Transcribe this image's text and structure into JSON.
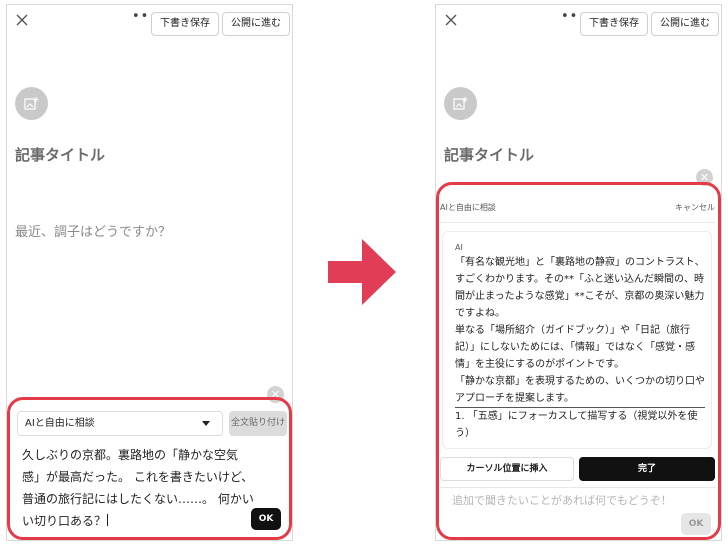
{
  "editor": {
    "more_menu": "•••",
    "draft_button": "下書き保存",
    "publish_button": "公開に進む",
    "title_placeholder": "記事タイトル",
    "body_placeholder": "最近、調子はどうですか？"
  },
  "left_panel": {
    "mode_select": "AIと自由に相談",
    "paste_all_button": "全文貼り付け",
    "input_lines": [
      "久しぶりの京都。裏路地の「静かな空気",
      "感」が最高だった。 これを書きたいけど、",
      "普通の旅行記にはしたくない……。 何かい",
      "い切り口ある？"
    ],
    "ok_button": "OK"
  },
  "right_panel": {
    "header_title": "AIと自由に相談",
    "cancel_label": "キャンセル",
    "ai_label": "AI",
    "ai_paragraphs": [
      "「有名な観光地」と「裏路地の静寂」のコントラスト、すごくわかります。その**「ふと迷い込んだ瞬間の、時間が止まったような感覚」**こそが、京都の奥深い魅力ですよね。",
      "単なる「場所紹介（ガイドブック）」や「日記（旅行記）」にしないためには、「情報」ではなく「感覚・感情」を主役にするのがポイントです。",
      "「静かな京都」を表現するための、いくつかの切り口やアプローチを提案します。",
      "1. 「五感」にフォーカスして描写する（視覚以外を使う）"
    ],
    "insert_button": "カーソル位置に挿入",
    "done_button": "完了",
    "followup_placeholder": "追加で聞きたいことがあれば何でもどうぞ！",
    "ok_button": "OK"
  },
  "colors": {
    "highlight_frame": "#e43b48",
    "arrow": "#e23d57",
    "primary_button": "#111111"
  },
  "icons": [
    "close-icon",
    "more-icon",
    "add-image-icon",
    "dismiss-icon",
    "chevron-down-icon",
    "right-arrow-icon"
  ]
}
